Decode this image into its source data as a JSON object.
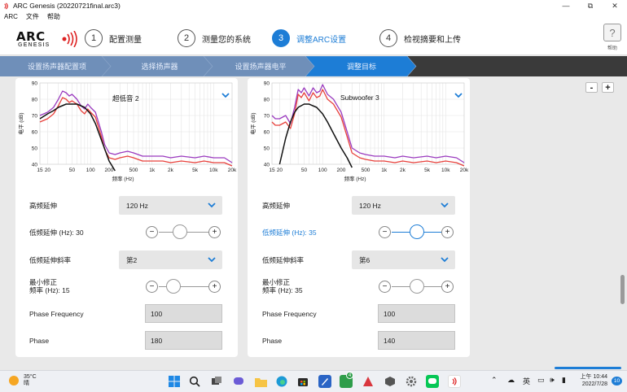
{
  "window": {
    "title": "ARC Genesis (20220721final.arc3)",
    "minimize_glyph": "—",
    "maximize_glyph": "⧉",
    "close_glyph": "✕"
  },
  "menu": [
    "ARC",
    "文件",
    "帮助"
  ],
  "logo": {
    "line1": "ARC",
    "line2": "GENESIS"
  },
  "steps": [
    {
      "number": "1",
      "label": "配置测量",
      "active": false
    },
    {
      "number": "2",
      "label": "测量您的系统",
      "active": false
    },
    {
      "number": "3",
      "label": "调整ARC设置",
      "active": true
    },
    {
      "number": "4",
      "label": "检视摘要和上传",
      "active": false
    }
  ],
  "help": {
    "glyph": "?",
    "label": "帮助"
  },
  "breadcrumbs": [
    "设置扬声器配置项",
    "选择扬声器",
    "设置扬声器电平",
    "调整目标"
  ],
  "zoom": {
    "minus": "-",
    "plus": "+"
  },
  "chart_axes": {
    "ylabel": "电平 (dB)",
    "xlabel": "频率 (Hz)",
    "y_ticks": [
      "90",
      "80",
      "70",
      "60",
      "50",
      "40"
    ],
    "x_ticks": [
      "15",
      "20",
      "50",
      "100",
      "200",
      "500",
      "1k",
      "2k",
      "5k",
      "10k",
      "20k"
    ]
  },
  "chart_data": [
    {
      "type": "line",
      "title": "超低音 2",
      "xscale": "log",
      "xlim": [
        15,
        20000
      ],
      "ylim": [
        40,
        90
      ],
      "xlabel": "频率 (Hz)",
      "ylabel": "电平 (dB)",
      "grid": true,
      "series": [
        {
          "color": "#9b3bbf",
          "x": [
            15,
            20,
            25,
            30,
            35,
            40,
            45,
            50,
            60,
            70,
            80,
            90,
            100,
            120,
            150,
            170,
            200,
            250,
            300,
            400,
            500,
            700,
            1000,
            1500,
            2000,
            3000,
            5000,
            7000,
            10000,
            15000,
            20000
          ],
          "y": [
            70,
            72,
            75,
            80,
            85,
            84,
            82,
            83,
            80,
            76,
            74,
            77,
            75,
            72,
            60,
            52,
            47,
            46,
            47,
            48,
            47,
            45,
            45,
            45,
            44,
            45,
            44,
            45,
            44,
            44,
            41
          ]
        },
        {
          "color": "#e8413c",
          "x": [
            15,
            20,
            25,
            30,
            35,
            40,
            45,
            50,
            60,
            70,
            80,
            90,
            100,
            120,
            150,
            170,
            200,
            250,
            300,
            400,
            500,
            700,
            1000,
            1500,
            2000,
            3000,
            5000,
            7000,
            10000,
            15000,
            20000
          ],
          "y": [
            66,
            68,
            71,
            76,
            81,
            80,
            78,
            79,
            77,
            73,
            71,
            74,
            72,
            69,
            57,
            49,
            44,
            43,
            44,
            45,
            44,
            42,
            42,
            42,
            41,
            42,
            41,
            42,
            41,
            41,
            39
          ]
        },
        {
          "color": "#111111",
          "x": [
            15,
            20,
            25,
            30,
            40,
            50,
            60,
            80,
            100,
            120,
            150,
            200,
            250
          ],
          "y": [
            68,
            71,
            73,
            75,
            77,
            77,
            77,
            75,
            71,
            65,
            55,
            42,
            36
          ]
        }
      ]
    },
    {
      "type": "line",
      "title": "Subwoofer 3",
      "xscale": "log",
      "xlim": [
        15,
        20000
      ],
      "ylim": [
        40,
        90
      ],
      "xlabel": "频率 (Hz)",
      "ylabel": "电平 (dB)",
      "grid": true,
      "series": [
        {
          "color": "#9b3bbf",
          "x": [
            15,
            17,
            20,
            25,
            30,
            35,
            40,
            45,
            50,
            60,
            70,
            80,
            90,
            100,
            120,
            150,
            200,
            250,
            300,
            400,
            500,
            700,
            1000,
            1500,
            2000,
            3000,
            5000,
            7000,
            10000,
            15000,
            20000
          ],
          "y": [
            70,
            68,
            68,
            70,
            65,
            75,
            86,
            84,
            87,
            82,
            87,
            84,
            85,
            89,
            83,
            80,
            72,
            60,
            50,
            47,
            46,
            45,
            45,
            44,
            45,
            44,
            45,
            44,
            45,
            44,
            41
          ]
        },
        {
          "color": "#e8413c",
          "x": [
            15,
            17,
            20,
            25,
            30,
            35,
            40,
            45,
            50,
            60,
            70,
            80,
            90,
            100,
            120,
            150,
            200,
            250,
            300,
            400,
            500,
            700,
            1000,
            1500,
            2000,
            3000,
            5000,
            7000,
            10000,
            15000,
            20000
          ],
          "y": [
            66,
            64,
            64,
            66,
            62,
            71,
            83,
            81,
            84,
            79,
            84,
            81,
            82,
            86,
            80,
            77,
            69,
            57,
            47,
            44,
            43,
            42,
            42,
            41,
            42,
            41,
            42,
            41,
            42,
            41,
            39
          ]
        },
        {
          "color": "#111111",
          "x": [
            20,
            25,
            30,
            35,
            40,
            50,
            60,
            80,
            100,
            120,
            150,
            200,
            250,
            300
          ],
          "y": [
            40,
            56,
            66,
            72,
            75,
            77,
            77,
            75,
            71,
            66,
            59,
            50,
            44,
            38
          ]
        }
      ]
    }
  ],
  "panels": [
    {
      "high_ext_label": "高频延伸",
      "high_ext_value": "120 Hz",
      "low_ext_label": "低频延伸 (Hz): 30",
      "low_ext_level": 0.42,
      "slope_label": "低频延伸斜率",
      "slope_value": "第2",
      "min_corr_label_1": "最小修正",
      "min_corr_label_2": "频率 (Hz): 15",
      "min_corr_level": 0.3,
      "phase_freq_label": "Phase Frequency",
      "phase_freq_value": "100",
      "phase_label": "Phase",
      "phase_value": "180"
    },
    {
      "high_ext_label": "高频延伸",
      "high_ext_value": "120 Hz",
      "low_ext_label": "低频延伸 (Hz): 35",
      "low_ext_level": 0.5,
      "slope_label": "低频延伸斜率",
      "slope_value": "第6",
      "min_corr_label_1": "最小修正",
      "min_corr_label_2": "频率 (Hz): 35",
      "min_corr_level": 0.5,
      "phase_freq_label": "Phase Frequency",
      "phase_freq_value": "100",
      "phase_label": "Phase",
      "phase_value": "140"
    }
  ],
  "slider": {
    "minus": "−",
    "plus": "+"
  },
  "taskbar": {
    "temp": "35°C",
    "weather": "晴",
    "chat_badge": "4",
    "lang": "英",
    "time": "上午 10:44",
    "date": "2022/7/28",
    "notif_count": "10"
  },
  "colors": {
    "accent": "#1d7dd6",
    "purple": "#9b3bbf",
    "red": "#e8413c",
    "black": "#111111"
  }
}
